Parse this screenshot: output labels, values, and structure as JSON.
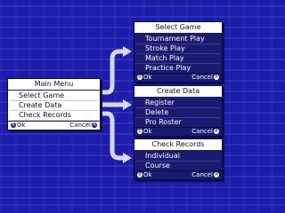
{
  "main_menu": {
    "title": "Main Menu",
    "items": [
      "Select Game",
      "Create Data",
      "Check Records"
    ],
    "ok_icon": "B",
    "ok_label": "Ok",
    "cancel_label": "Cancel",
    "cancel_icon": "A"
  },
  "select_game": {
    "title": "Select Game",
    "items": [
      "Tournament Play",
      "Stroke Play",
      "Match Play",
      "Practice Play"
    ],
    "ok_icon": "B",
    "ok_label": "Ok",
    "cancel_label": "Cancel",
    "cancel_icon": "A"
  },
  "create_data": {
    "title": "Create Data",
    "items": [
      "Register",
      "Delete",
      "Pro Roster"
    ],
    "ok_icon": "B",
    "ok_label": "Ok",
    "cancel_label": "Cancel",
    "cancel_icon": "A"
  },
  "check_records": {
    "title": "Check Records",
    "items": [
      "Individual",
      "Course"
    ],
    "ok_icon": "B",
    "ok_label": "Ok",
    "cancel_label": "Cancel",
    "cancel_icon": "A"
  },
  "colors": {
    "background": "#1c1ca8",
    "panel_dark": "#1a1a6e",
    "panel_light": "#ffffff",
    "arrow": "#d8d8f0"
  }
}
